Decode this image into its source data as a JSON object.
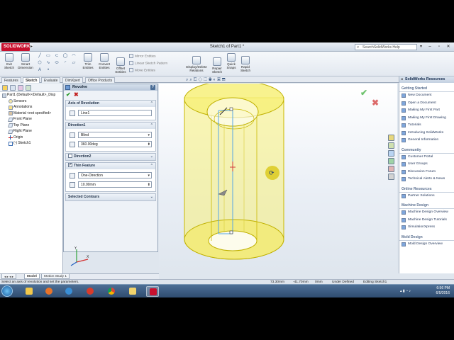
{
  "app": {
    "logo": "SOLIDWORKS",
    "document_title": "Sketch1 of Part1 *",
    "help_search_placeholder": "SearchSolidWorks Help",
    "help_search_arrow": "▾"
  },
  "commands": {
    "large": [
      {
        "label": "Exit\nSketch",
        "name": "exit-sketch-button"
      },
      {
        "label": "Smart\nDimension",
        "name": "smart-dimension-button"
      },
      {
        "label": "Trim\nEntities",
        "name": "trim-entities-button"
      },
      {
        "label": "Convert\nEntities",
        "name": "convert-entities-button"
      },
      {
        "label": "Offset\nEntities",
        "name": "offset-entities-button"
      },
      {
        "label": "Display/Delete\nRelations",
        "name": "display-delete-relations-button"
      },
      {
        "label": "Repair\nSketch",
        "name": "repair-sketch-button"
      },
      {
        "label": "Quick\nSnaps",
        "name": "quick-snaps-button"
      },
      {
        "label": "Rapid\nSketch",
        "name": "rapid-sketch-button"
      }
    ],
    "small": [
      "Mirror Entities",
      "Linear Sketch Pattern",
      "Move Entities"
    ]
  },
  "tabs": [
    "Features",
    "Sketch",
    "Evaluate",
    "DimXpert",
    "Office Products"
  ],
  "active_tab": "Sketch",
  "tree": {
    "root": "Part1  (Default<<Default>_Disp",
    "items": [
      {
        "label": "Sensors",
        "icon": "sensor"
      },
      {
        "label": "Annotations",
        "icon": "annot"
      },
      {
        "label": "Material <not specified>",
        "icon": "mat"
      },
      {
        "label": "Front Plane",
        "icon": "plane"
      },
      {
        "label": "Top Plane",
        "icon": "plane"
      },
      {
        "label": "Right Plane",
        "icon": "plane"
      },
      {
        "label": "Origin",
        "icon": "origin"
      },
      {
        "label": "(-) Sketch1",
        "icon": "sketch"
      }
    ]
  },
  "property_manager": {
    "title": "Revolve",
    "groups": {
      "axis": {
        "title": "Axis of Revolution",
        "value": "Line1"
      },
      "direction1": {
        "title": "Direction1",
        "type": "Blind",
        "angle": "360.00deg"
      },
      "direction2": {
        "title": "Direction2"
      },
      "thin": {
        "title": "Thin Feature",
        "type": "One-Direction",
        "thickness": "10.00mm"
      },
      "contours": {
        "title": "Selected Contours"
      }
    }
  },
  "task_pane": {
    "title": "SolidWorks Resources",
    "sections": [
      {
        "title": "Getting Started",
        "links": [
          "New Document",
          "Open a Document",
          "Making My First Part",
          "Making My First Drawing",
          "Tutorials",
          "Introducing SolidWorks",
          "General Information"
        ]
      },
      {
        "title": "Community",
        "links": [
          "Customer Portal",
          "User Groups",
          "Discussion Forum",
          "Technical Alerts & News"
        ]
      },
      {
        "title": "Online Resources",
        "links": [
          "Partner Solutions"
        ]
      },
      {
        "title": "Machine Design",
        "links": [
          "Machine Design Overview",
          "Machine Design Tutorials",
          "SimulationXpress"
        ]
      },
      {
        "title": "Mold Design",
        "links": [
          "Mold Design Overview"
        ]
      }
    ]
  },
  "model_tabs": [
    "Model",
    "Motion Study 1"
  ],
  "status": {
    "message": "Select an axis of revolution and set the parameters.",
    "x": "73.30mm",
    "y": "-41.70mm",
    "z": "0mm",
    "state": "Under Defined",
    "mode": "Editing Sketch1"
  },
  "clock": {
    "time": "6:56 PM",
    "date": "6/5/2016"
  },
  "colors": {
    "accent": "#c8102e",
    "model_fill": "#f7f07a",
    "model_edge": "#c9b800",
    "sketch_line": "#55a6e6"
  }
}
